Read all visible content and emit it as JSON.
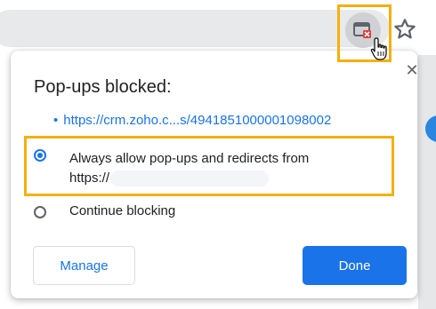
{
  "toolbar": {
    "popup_blocked_icon": "popup-blocked-icon",
    "star_icon": "star-icon",
    "cursor_icon": "hand-pointer-icon"
  },
  "bubble": {
    "title": "Pop-ups blocked:",
    "close_icon": "close-icon",
    "close_glyph": "✕",
    "blocked_url_bullet": "•",
    "blocked_url": "https://crm.zoho.c...s/4941851000001098002",
    "options": [
      {
        "label_line1": "Always allow pop-ups and redirects from",
        "label_line2": "https://",
        "selected": true
      },
      {
        "label": "Continue blocking",
        "selected": false
      }
    ],
    "manage_label": "Manage",
    "done_label": "Done"
  },
  "colors": {
    "accent": "#1a73e8",
    "highlight": "#f5b00b",
    "popup_icon_red": "#e53935"
  }
}
